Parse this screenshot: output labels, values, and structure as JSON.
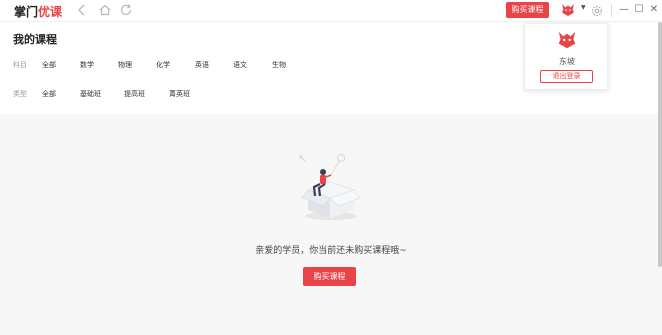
{
  "app": {
    "logo_part1": "掌门",
    "logo_part2": "优课"
  },
  "titlebar": {
    "back_icon": "chevron-left-icon",
    "home_icon": "home-icon",
    "refresh_icon": "refresh-icon",
    "buy_label": "购买课程",
    "settings_icon": "gear-icon",
    "minimize_label": "—",
    "maximize_label": "☐",
    "close_label": "✕"
  },
  "user_menu": {
    "username": "东坡",
    "logout_label": "退出登录"
  },
  "page": {
    "title": "我的课程"
  },
  "filters": {
    "subject": {
      "label": "科目",
      "options": [
        "全部",
        "数学",
        "物理",
        "化学",
        "英语",
        "语文",
        "生物"
      ]
    },
    "type": {
      "label": "类型",
      "options": [
        "全部",
        "基础班",
        "提高班",
        "菁英班"
      ]
    }
  },
  "empty_state": {
    "message": "亲爱的学员，你当前还未购买课程哦~",
    "button_label": "购买课程"
  },
  "colors": {
    "accent": "#e84548",
    "content_bg": "#f7f7f7"
  }
}
